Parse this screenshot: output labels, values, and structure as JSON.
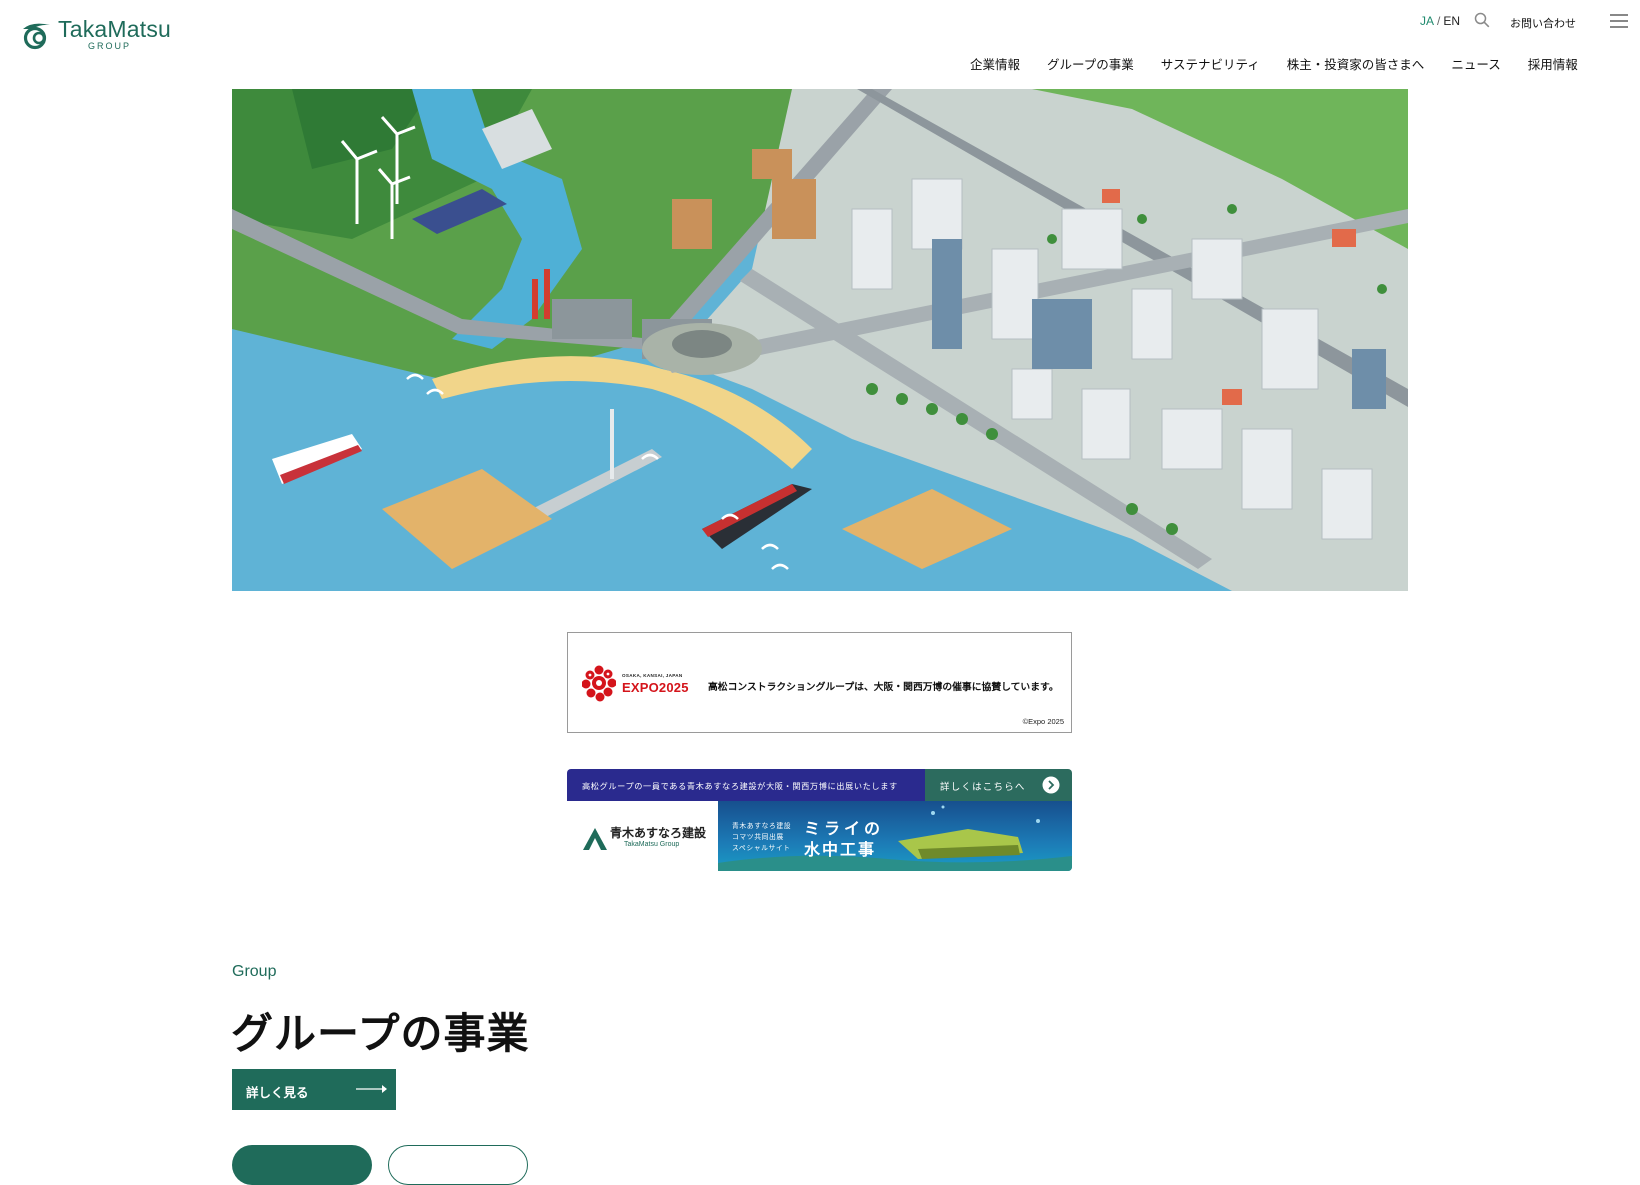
{
  "header": {
    "logo_name": "TakaMatsu",
    "logo_sub": "GROUP",
    "lang_ja": "JA",
    "lang_sep": "/",
    "lang_en": "EN",
    "contact": "お問い合わせ",
    "nav": [
      {
        "label": "企業情報"
      },
      {
        "label": "グループの事業"
      },
      {
        "label": "サステナビリティ"
      },
      {
        "label": "株主・投資家の皆さまへ"
      },
      {
        "label": "ニュース"
      },
      {
        "label": "採用情報"
      }
    ]
  },
  "expo_banner": {
    "logo_small": "OSAKA, KANSAI, JAPAN",
    "logo_title": "EXPO2025",
    "text": "高松コンストラクショングループは、大阪・関西万博の催事に協賛しています。",
    "copyright": "©Expo 2025"
  },
  "aoki_banner": {
    "top_text": "高松グループの一員である青木あすなろ建設が大阪・関西万博に出展いたします",
    "cta": "詳しくはこちらへ",
    "company": "青木あすなろ建設",
    "group": "TakaMatsu Group",
    "sub": "青木あすなろ建設\nコマツ共同出展\nスペシャルサイト",
    "title_line1": "ミライの",
    "title_line2": "水中工事"
  },
  "group_section": {
    "label": "Group",
    "title": "グループの事業",
    "more": "詳しく見る"
  },
  "colors": {
    "brand_green": "#1f6b5a",
    "accent_ja": "#1f8a6e",
    "expo_red": "#d4141b",
    "aoki_navy": "#2a2a8e"
  }
}
